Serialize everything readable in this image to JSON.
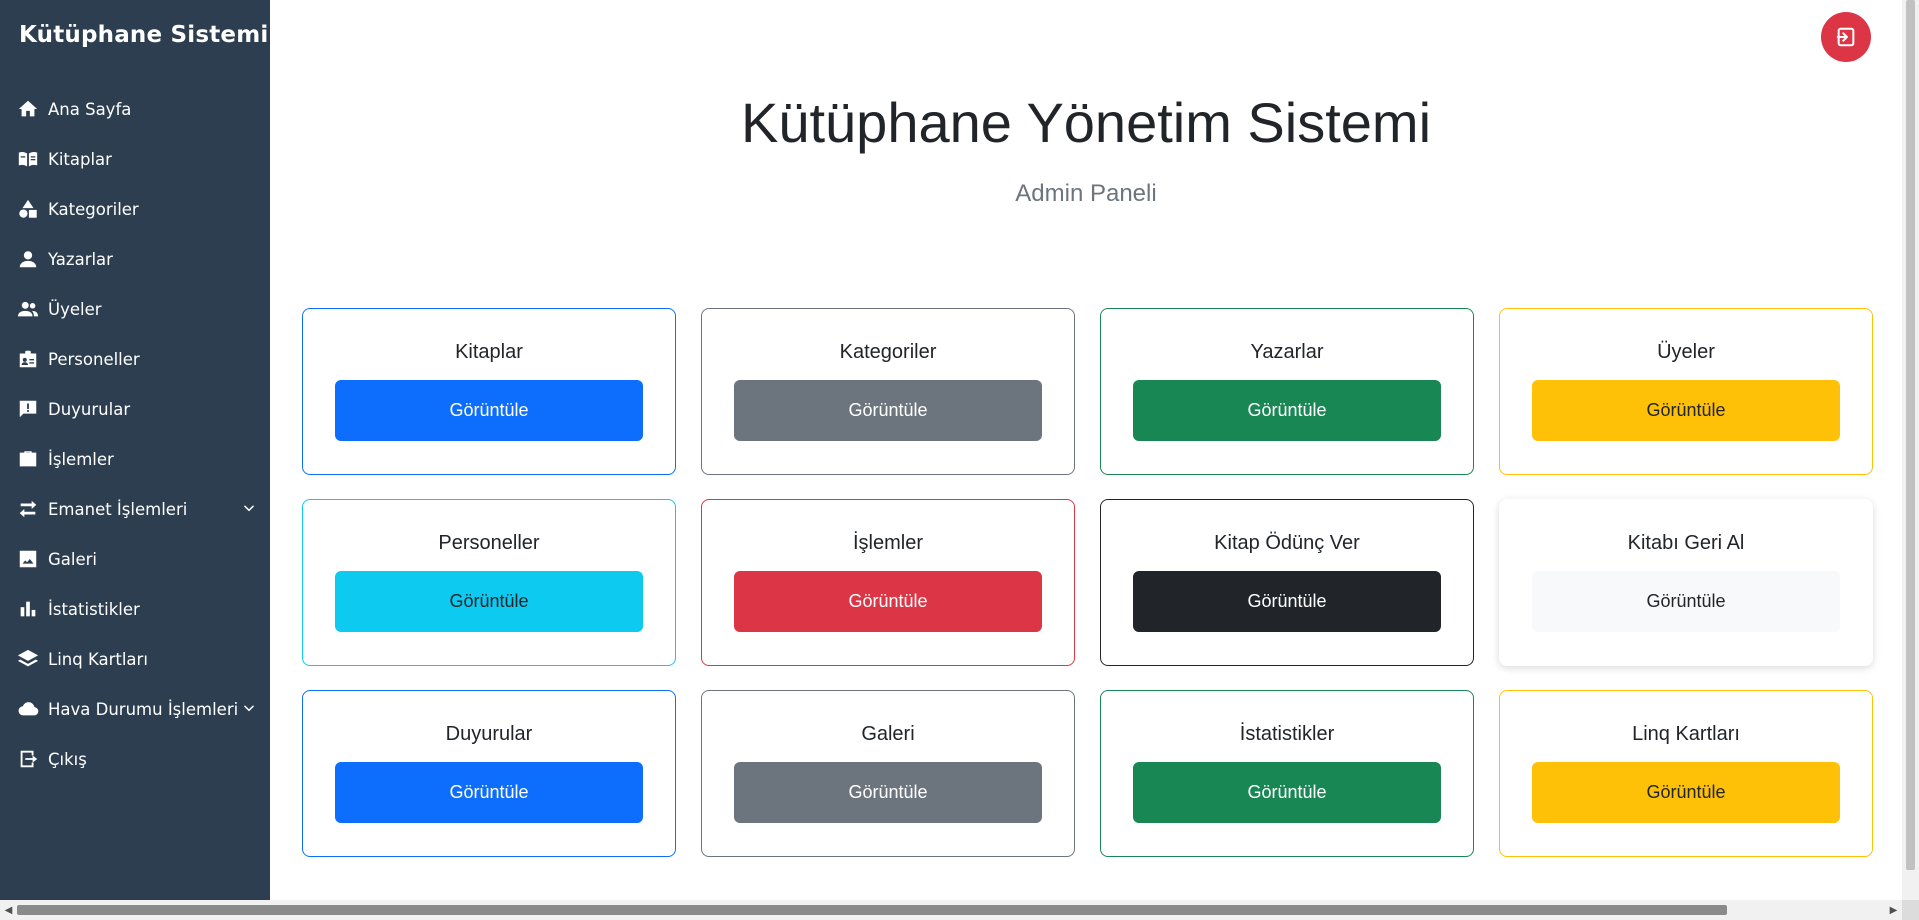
{
  "brand": "Kütüphane Sistemi",
  "nav": [
    {
      "label": "Ana Sayfa",
      "icon": "home-icon"
    },
    {
      "label": "Kitaplar",
      "icon": "book-open-icon"
    },
    {
      "label": "Kategoriler",
      "icon": "shapes-icon"
    },
    {
      "label": "Yazarlar",
      "icon": "user-icon"
    },
    {
      "label": "Üyeler",
      "icon": "users-icon"
    },
    {
      "label": "Personeller",
      "icon": "id-badge-icon"
    },
    {
      "label": "Duyurular",
      "icon": "announcement-icon"
    },
    {
      "label": "İşlemler",
      "icon": "briefcase-icon"
    },
    {
      "label": "Emanet İşlemleri",
      "icon": "swap-arrows-icon",
      "dropdown": true
    },
    {
      "label": "Galeri",
      "icon": "image-icon"
    },
    {
      "label": "İstatistikler",
      "icon": "bar-chart-icon"
    },
    {
      "label": "Linq Kartları",
      "icon": "layers-icon"
    },
    {
      "label": "Hava Durumu İşlemleri",
      "icon": "cloud-icon",
      "dropdown": true
    },
    {
      "label": "Çıkış",
      "icon": "logout-icon"
    }
  ],
  "header": {
    "title": "Kütüphane Yönetim Sistemi",
    "subtitle": "Admin Paneli"
  },
  "cards": [
    {
      "title": "Kitaplar",
      "button": "Görüntüle",
      "color": "#0d6efd",
      "text_color": "#ffffff"
    },
    {
      "title": "Kategoriler",
      "button": "Görüntüle",
      "color": "#6c757d",
      "text_color": "#ffffff"
    },
    {
      "title": "Yazarlar",
      "button": "Görüntüle",
      "color": "#198754",
      "text_color": "#ffffff"
    },
    {
      "title": "Üyeler",
      "button": "Görüntüle",
      "color": "#ffc107",
      "text_color": "#212529"
    },
    {
      "title": "Personeller",
      "button": "Görüntüle",
      "color": "#0dcaf0",
      "text_color": "#212529"
    },
    {
      "title": "İşlemler",
      "button": "Görüntüle",
      "color": "#dc3545",
      "text_color": "#ffffff"
    },
    {
      "title": "Kitap Ödünç Ver",
      "button": "Görüntüle",
      "color": "#212529",
      "text_color": "#ffffff"
    },
    {
      "title": "Kitabı Geri Al",
      "button": "Görüntüle",
      "color": "#f8f9fa",
      "text_color": "#212529",
      "border": "none"
    },
    {
      "title": "Duyurular",
      "button": "Görüntüle",
      "color": "#0d6efd",
      "text_color": "#ffffff"
    },
    {
      "title": "Galeri",
      "button": "Görüntüle",
      "color": "#6c757d",
      "text_color": "#ffffff"
    },
    {
      "title": "İstatistikler",
      "button": "Görüntüle",
      "color": "#198754",
      "text_color": "#ffffff"
    },
    {
      "title": "Linq Kartları",
      "button": "Görüntüle",
      "color": "#ffc107",
      "text_color": "#212529"
    }
  ],
  "colors": {
    "sidebar_bg": "#2c3e50",
    "logout_button": "#dc3545"
  }
}
